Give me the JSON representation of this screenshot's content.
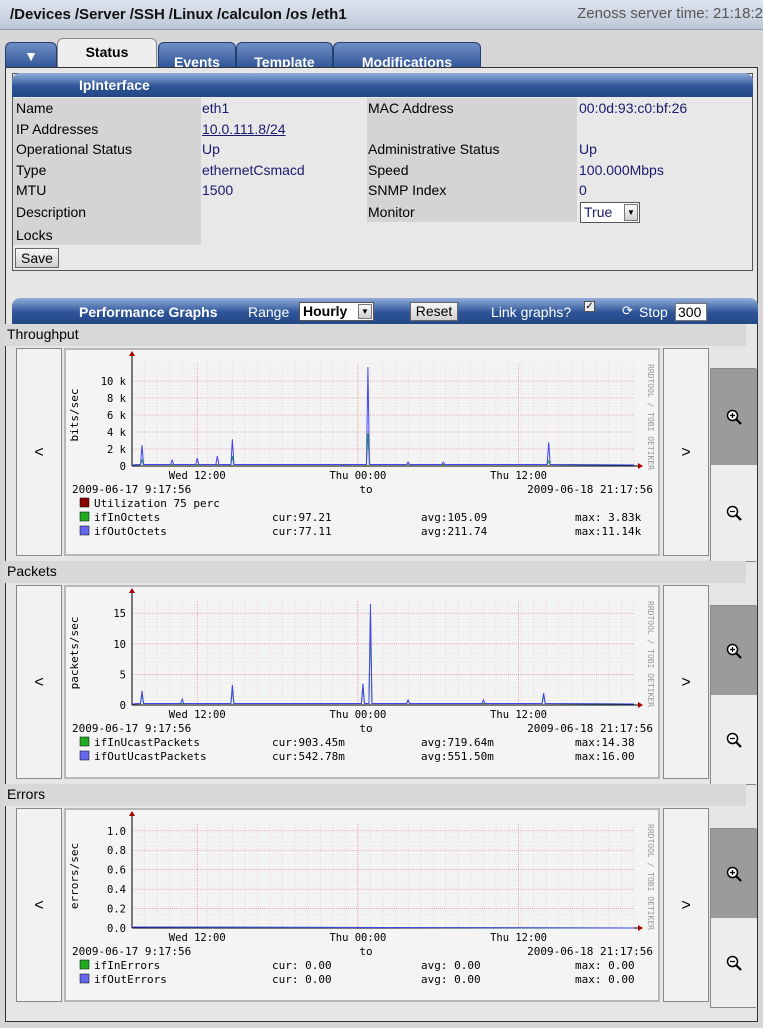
{
  "breadcrumb": [
    "/Devices",
    "/Server",
    "/SSH",
    "/Linux",
    "/calculon",
    "/os",
    "/eth1"
  ],
  "server_time": "Zenoss server time: 21:18:2",
  "tabs": {
    "menu_glyph": "▼",
    "status": "Status",
    "events": "Events",
    "template": "Template",
    "modifications": "Modifications"
  },
  "ipinterface": {
    "title": "IpInterface",
    "name_label": "Name",
    "name_value": "eth1",
    "mac_label": "MAC Address",
    "mac_value": "00:0d:93:c0:bf:26",
    "ip_label": "IP Addresses",
    "ip_value": "10.0.111.8/24",
    "opstatus_label": "Operational Status",
    "opstatus_value": "Up",
    "adminstatus_label": "Administrative Status",
    "adminstatus_value": "Up",
    "type_label": "Type",
    "type_value": "ethernetCsmacd",
    "speed_label": "Speed",
    "speed_value": "100.000Mbps",
    "mtu_label": "MTU",
    "mtu_value": "1500",
    "snmp_label": "SNMP Index",
    "snmp_value": "0",
    "desc_label": "Description",
    "monitor_label": "Monitor",
    "monitor_value": "True",
    "locks_label": "Locks",
    "save_label": "Save"
  },
  "perf": {
    "title": "Performance Graphs",
    "range_label": "Range",
    "range_value": "Hourly",
    "reset_label": "Reset",
    "link_label": "Link graphs?",
    "link_checked": true,
    "stop_label": "Stop",
    "stop_value": "300",
    "prev_glyph": "<",
    "next_glyph": ">",
    "zoom_in_icon": "zoom-in-icon",
    "zoom_out_icon": "zoom-out-icon"
  },
  "graphs": [
    {
      "section": "Throughput",
      "ylabel": "bits/sec",
      "yticks": [
        "10 k",
        "8 k",
        "6 k",
        "4 k",
        "2 k",
        "0"
      ],
      "ymax": 12000,
      "ytick_values": [
        10000,
        8000,
        6000,
        4000,
        2000,
        0
      ],
      "xticks": [
        "Wed 12:00",
        "Thu 00:00",
        "Thu 12:00"
      ],
      "start": "2009-06-17 9:17:56",
      "to": "to",
      "end": "2009-06-18 21:17:56",
      "watermark": "RRDTOOL / TOBI OETIKER",
      "legend": [
        {
          "name": "Utilization 75 perc",
          "color": "#8b0000",
          "cur": "",
          "avg": "",
          "max": ""
        },
        {
          "name": "ifInOctets",
          "color": "#22aa22",
          "cur": "cur:97.21",
          "avg": "avg:105.09",
          "max": "max: 3.83k"
        },
        {
          "name": "ifOutOctets",
          "color": "#6666ee",
          "cur": "cur:77.11",
          "avg": "avg:211.74",
          "max": "max:11.14k"
        }
      ]
    },
    {
      "section": "Packets",
      "ylabel": "packets/sec",
      "yticks": [
        "15",
        "10",
        "5",
        "0"
      ],
      "ymax": 17,
      "ytick_values": [
        15,
        10,
        5,
        0
      ],
      "xticks": [
        "Wed 12:00",
        "Thu 00:00",
        "Thu 12:00"
      ],
      "start": "2009-06-17 9:17:56",
      "to": "to",
      "end": "2009-06-18 21:17:56",
      "watermark": "RRDTOOL / TOBI OETIKER",
      "legend": [
        {
          "name": "ifInUcastPackets",
          "color": "#22aa22",
          "cur": "cur:903.45m",
          "avg": "avg:719.64m",
          "max": "max:14.38"
        },
        {
          "name": "ifOutUcastPackets",
          "color": "#6666ee",
          "cur": "cur:542.78m",
          "avg": "avg:551.50m",
          "max": "max:16.00"
        }
      ]
    },
    {
      "section": "Errors",
      "ylabel": "errors/sec",
      "yticks": [
        "1.0",
        "0.8",
        "0.6",
        "0.4",
        "0.2",
        "0.0"
      ],
      "ymax": 1.07,
      "ytick_values": [
        1.0,
        0.8,
        0.6,
        0.4,
        0.2,
        0.0
      ],
      "xticks": [
        "Wed 12:00",
        "Thu 00:00",
        "Thu 12:00"
      ],
      "start": "2009-06-17 9:17:56",
      "to": "to",
      "end": "2009-06-18 21:17:56",
      "watermark": "RRDTOOL / TOBI OETIKER",
      "legend": [
        {
          "name": "ifInErrors",
          "color": "#22aa22",
          "cur": "cur: 0.00",
          "avg": "avg: 0.00",
          "max": "max: 0.00"
        },
        {
          "name": "ifOutErrors",
          "color": "#6666ee",
          "cur": "cur: 0.00",
          "avg": "avg: 0.00",
          "max": "max: 0.00"
        }
      ]
    }
  ]
}
